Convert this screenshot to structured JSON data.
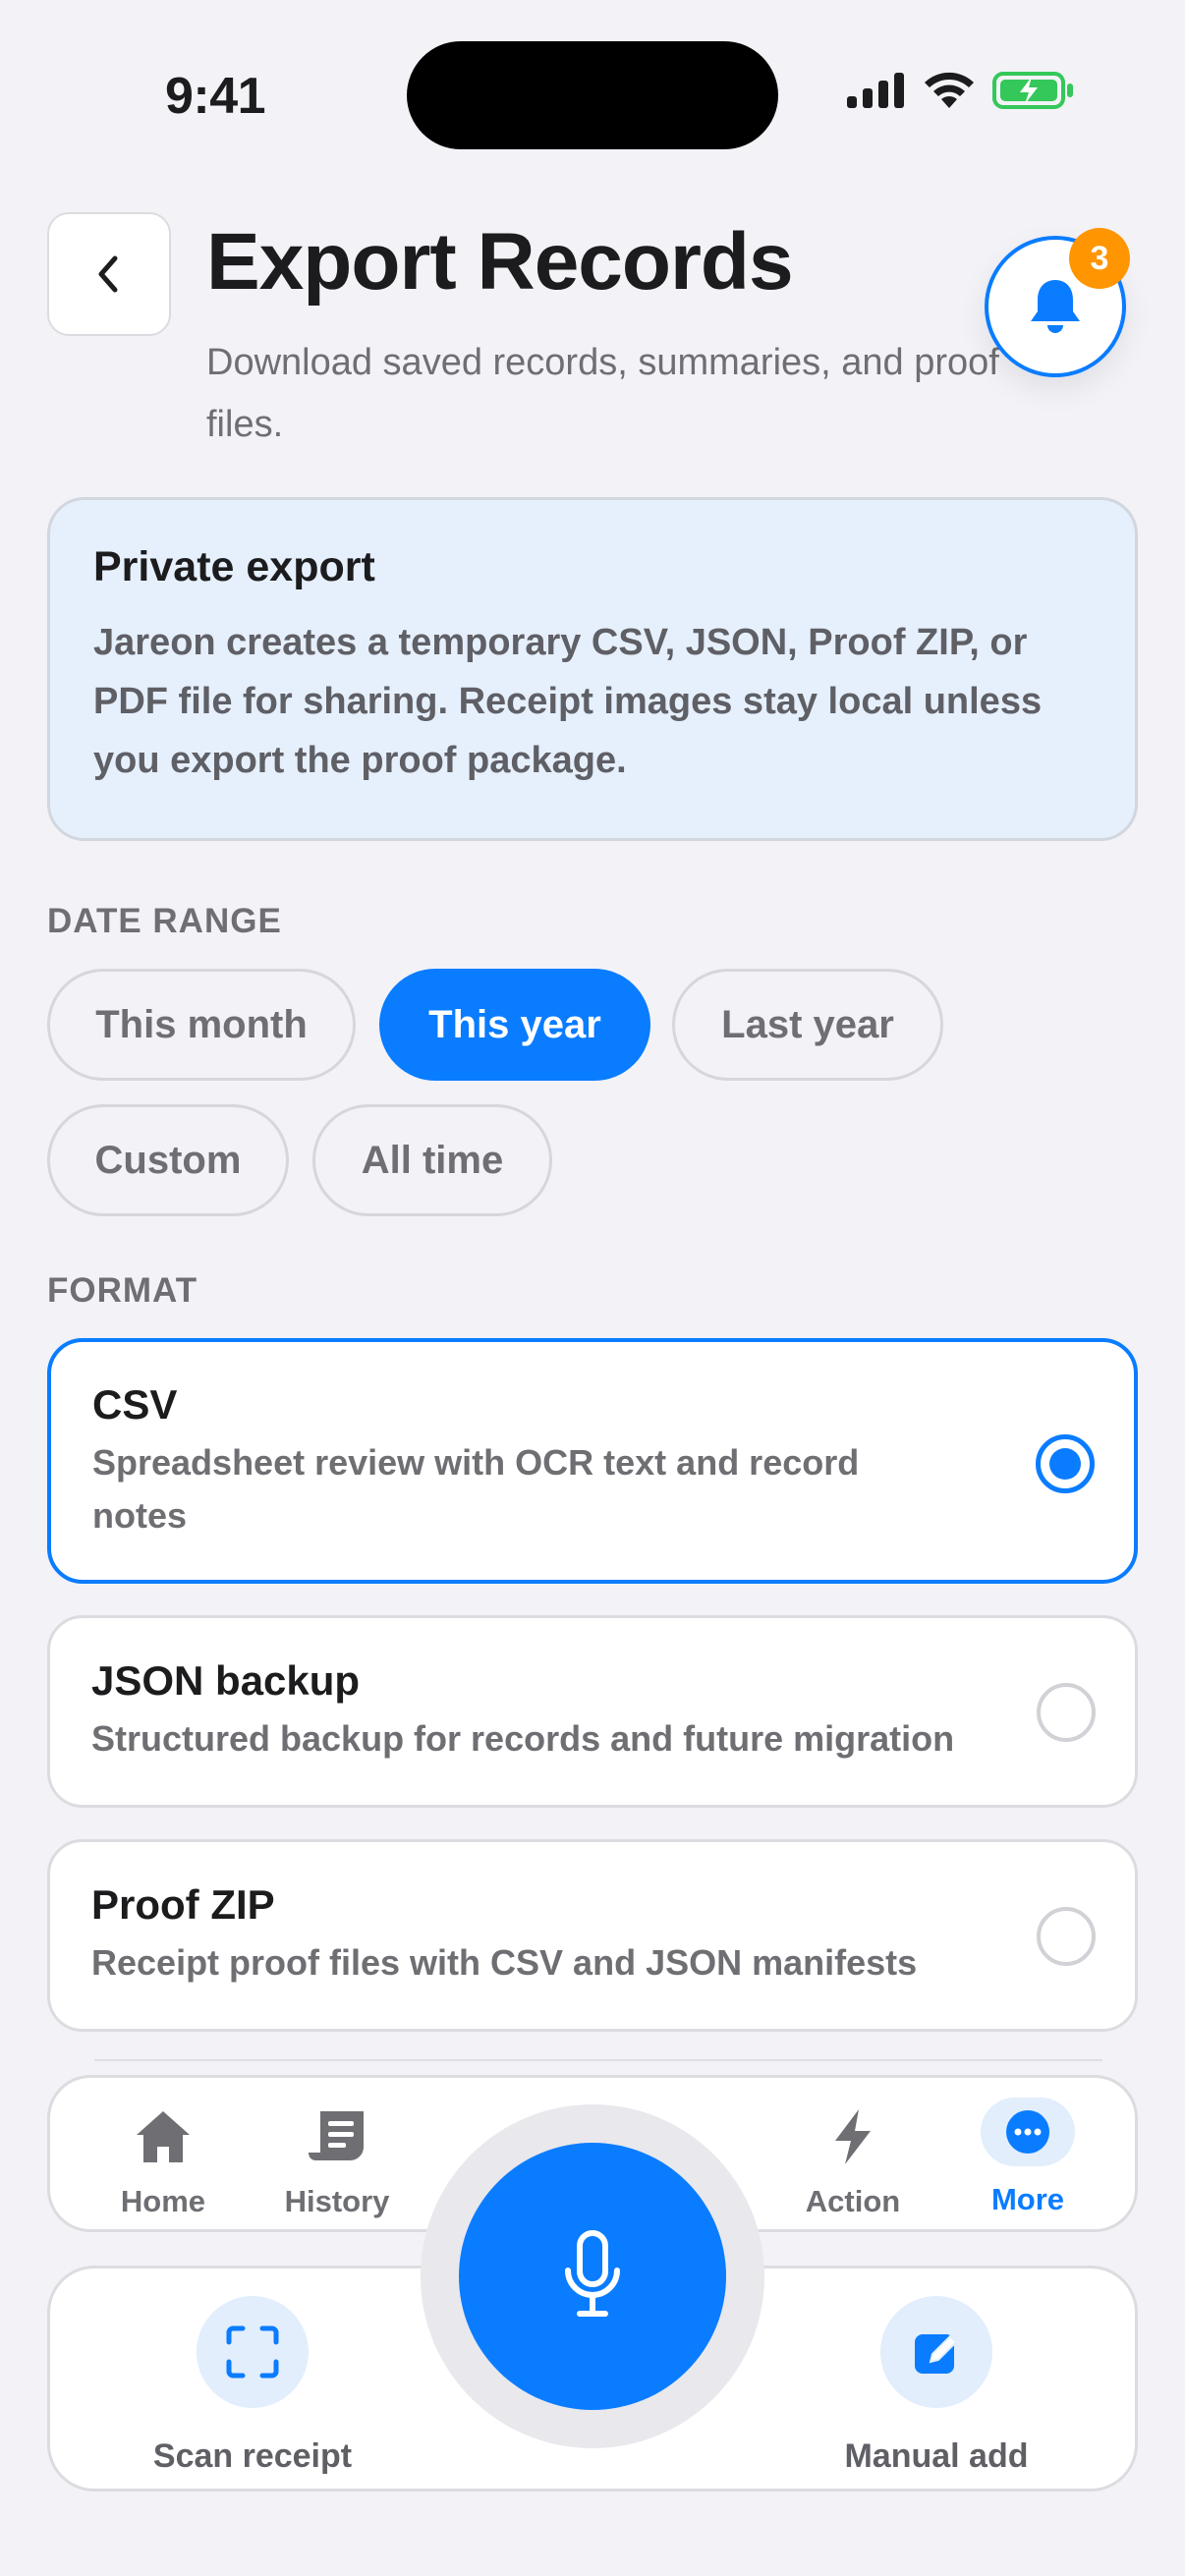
{
  "status_bar": {
    "time": "9:41"
  },
  "header": {
    "title": "Export Records",
    "subtitle": "Download saved records, summaries, and proof files.",
    "notification_count": "3"
  },
  "info_card": {
    "title": "Private export",
    "body": "Jareon creates a temporary CSV, JSON, Proof ZIP, or PDF file for sharing. Receipt images stay local unless you export the proof package."
  },
  "date_range": {
    "label": "DATE RANGE",
    "options": [
      "This month",
      "This year",
      "Last year",
      "Custom",
      "All time"
    ],
    "selected": "This year"
  },
  "format": {
    "label": "FORMAT",
    "options": [
      {
        "title": "CSV",
        "description": "Spreadsheet review with OCR text and record notes",
        "selected": true
      },
      {
        "title": "JSON backup",
        "description": "Structured backup for records and future migration",
        "selected": false
      },
      {
        "title": "Proof ZIP",
        "description": "Receipt proof files with CSV and JSON manifests",
        "selected": false
      }
    ]
  },
  "tab_bar": {
    "tabs": [
      {
        "label": "Home",
        "icon": "home-icon"
      },
      {
        "label": "History",
        "icon": "receipt-icon"
      },
      {
        "label": "Action",
        "icon": "bolt-icon"
      },
      {
        "label": "More",
        "icon": "more-icon"
      }
    ],
    "active": "More"
  },
  "quick_actions": {
    "scan_label": "Scan receipt",
    "manual_label": "Manual add"
  },
  "colors": {
    "accent": "#0a7cff",
    "badge": "#ff9500",
    "battery": "#34c759",
    "background": "#f2f2f7"
  }
}
